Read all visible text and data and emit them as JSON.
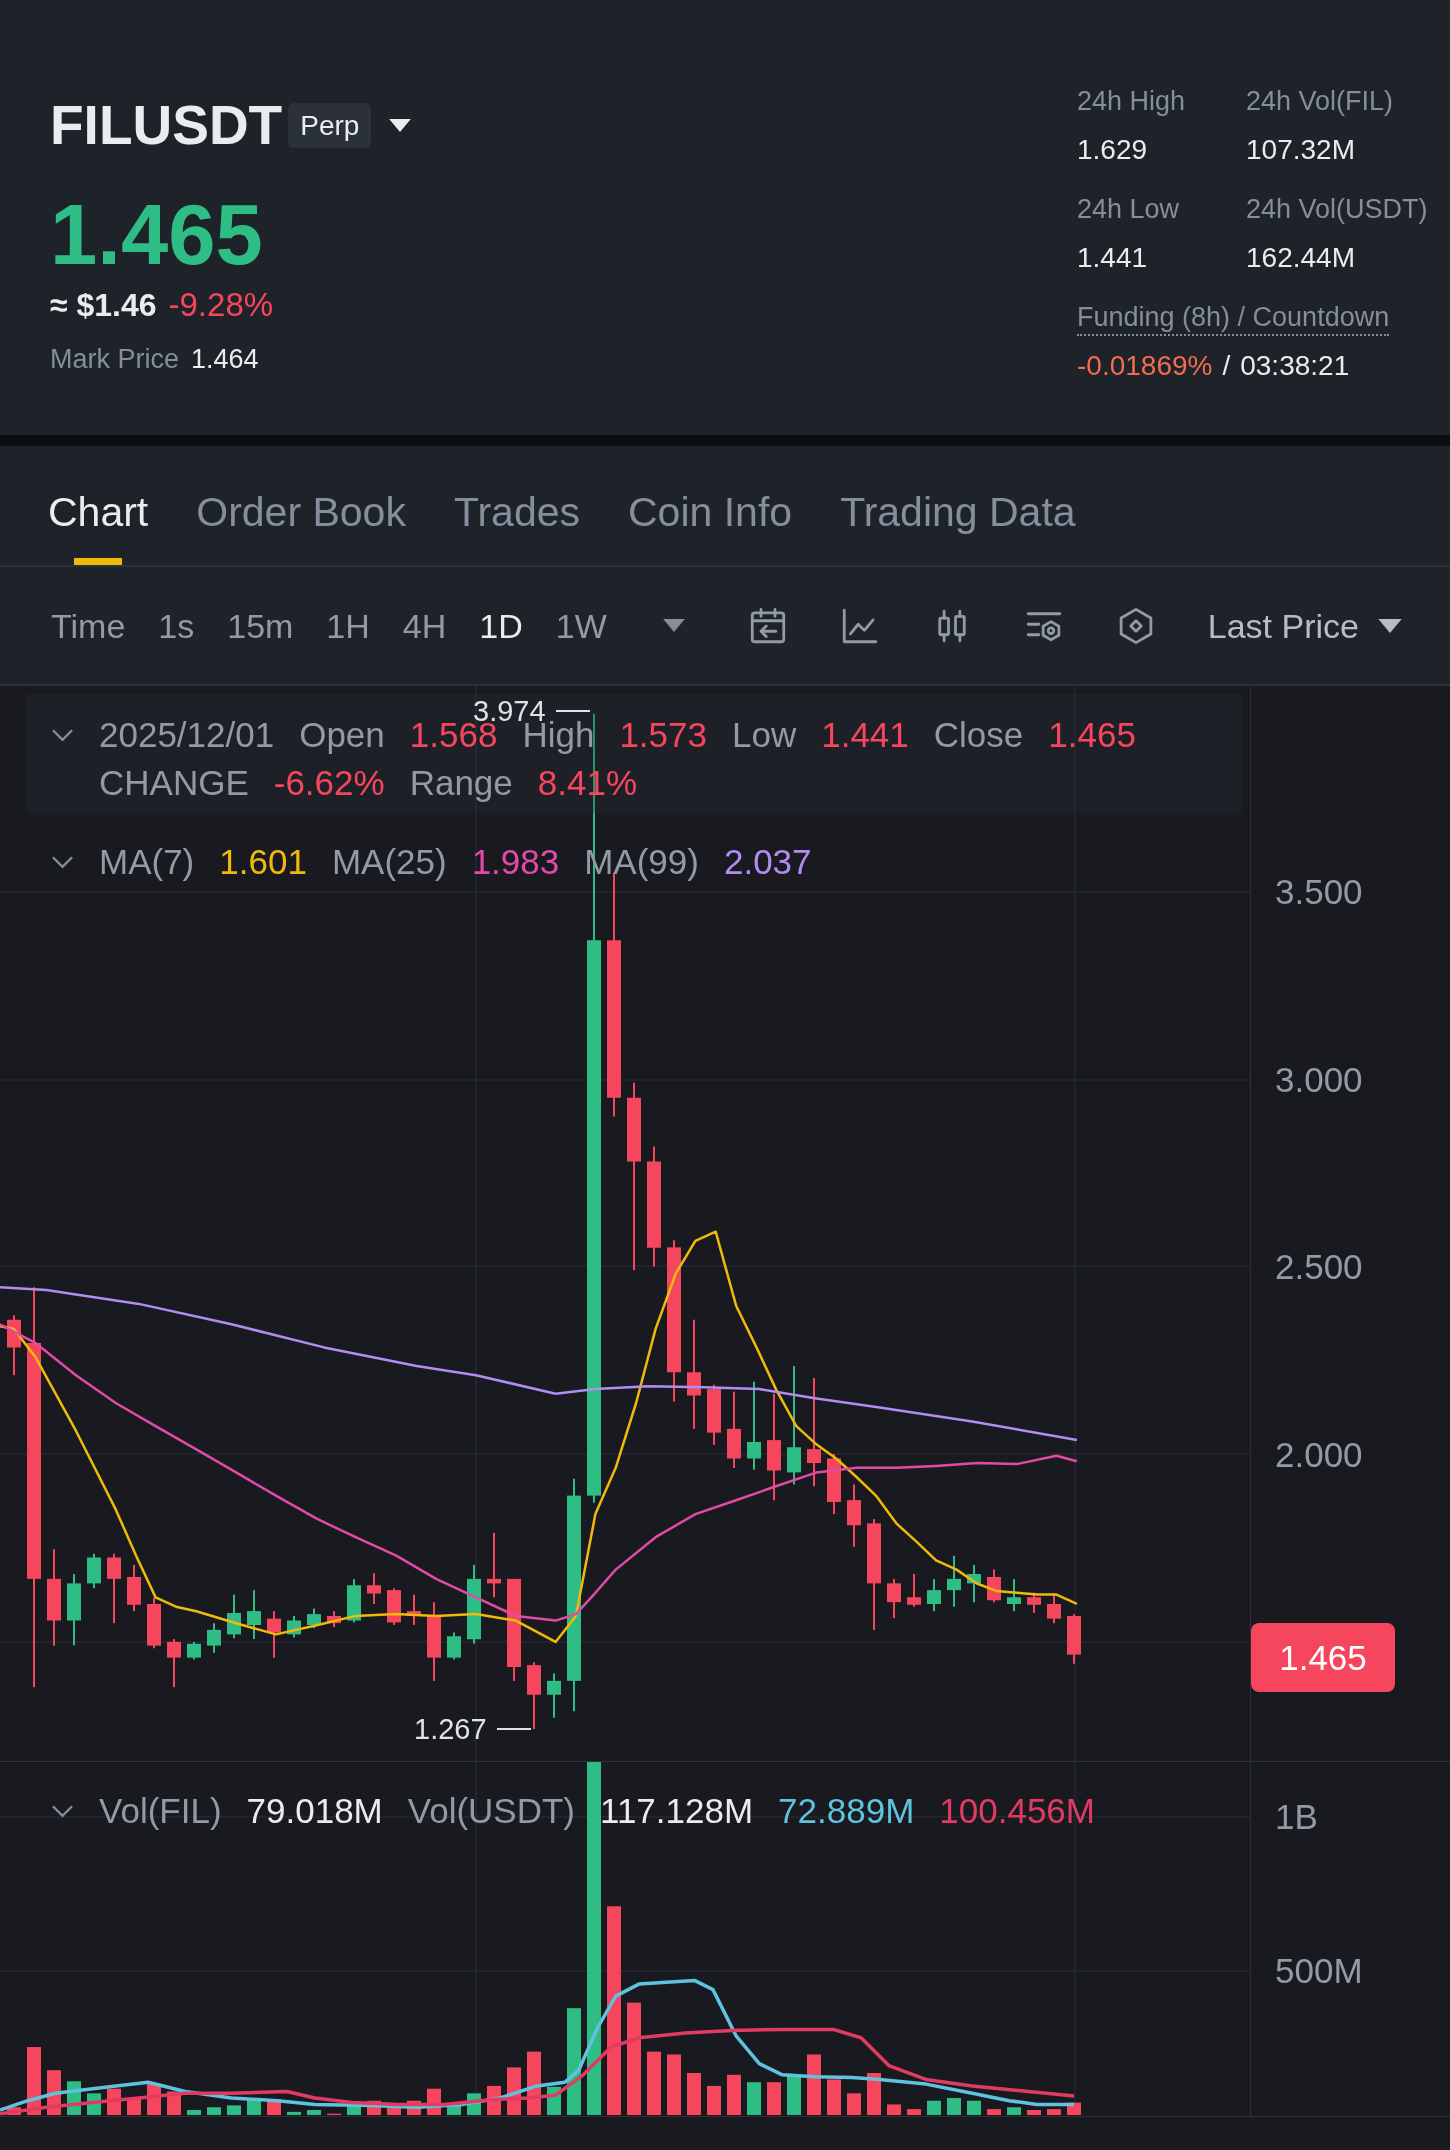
{
  "header": {
    "symbol": "FILUSDT",
    "contract_badge": "Perp",
    "last_price": "1.465",
    "last_price_rising": true,
    "usd_price": "≈ $1.46",
    "change_percent": "-9.28%",
    "change_rising": false,
    "mark_price": {
      "label": "Mark Price",
      "value": "1.464"
    },
    "stats": [
      {
        "label": "24h High",
        "value": "1.629"
      },
      {
        "label": "24h Vol(FIL)",
        "value": "107.32M"
      },
      {
        "label": "24h Low",
        "value": "1.441"
      },
      {
        "label": "24h Vol(USDT)",
        "value": "162.44M"
      }
    ],
    "funding": {
      "label": "Funding (8h) / Countdown",
      "rate": "-0.01869%",
      "separator": "/",
      "countdown": "03:38:21"
    }
  },
  "tabs": [
    {
      "label": "Chart",
      "selected": true
    },
    {
      "label": "Order Book",
      "selected": false
    },
    {
      "label": "Trades",
      "selected": false
    },
    {
      "label": "Coin Info",
      "selected": false
    },
    {
      "label": "Trading Data",
      "selected": false
    }
  ],
  "toolbar": {
    "intervals": [
      {
        "label": "Time",
        "selected": false
      },
      {
        "label": "1s",
        "selected": false
      },
      {
        "label": "15m",
        "selected": false
      },
      {
        "label": "1H",
        "selected": false
      },
      {
        "label": "4H",
        "selected": false
      },
      {
        "label": "1D",
        "selected": true
      },
      {
        "label": "1W",
        "selected": false
      }
    ],
    "price_source": "Last Price"
  },
  "price_chart": {
    "legend": {
      "date": "2025/12/01",
      "rising": false,
      "fields": [
        {
          "label": "Open",
          "value": "1.568"
        },
        {
          "label": "High",
          "value": "1.573"
        },
        {
          "label": "Low",
          "value": "1.441"
        },
        {
          "label": "Close",
          "value": "1.465"
        }
      ],
      "stats": [
        {
          "label": "CHANGE",
          "value": "-6.62%"
        },
        {
          "label": "Range",
          "value": "8.41%"
        }
      ]
    },
    "moving_averages": [
      {
        "label": "MA(7)",
        "value": "1.601",
        "color": "#f0b90b"
      },
      {
        "label": "MA(25)",
        "value": "1.983",
        "color": "#e14aa6"
      },
      {
        "label": "MA(99)",
        "value": "2.037",
        "color": "#b38cf2"
      }
    ],
    "high_marker": "3.974",
    "low_marker": "1.267",
    "y_axis_labels": [
      "3.500",
      "3.000",
      "2.500",
      "2.000"
    ],
    "price_tag": {
      "value": "1.465",
      "rising": false
    }
  },
  "volume_chart": {
    "legend": {
      "series": [
        {
          "label": "Vol(FIL)",
          "value": "79.018M"
        },
        {
          "label": "Vol(USDT)",
          "value": "117.128M"
        }
      ],
      "averages": [
        {
          "value": "72.889M",
          "color": "#5fc3df"
        },
        {
          "value": "100.456M",
          "color": "#e23b63"
        }
      ]
    },
    "y_axis_labels": [
      "1B",
      "500M"
    ]
  }
}
